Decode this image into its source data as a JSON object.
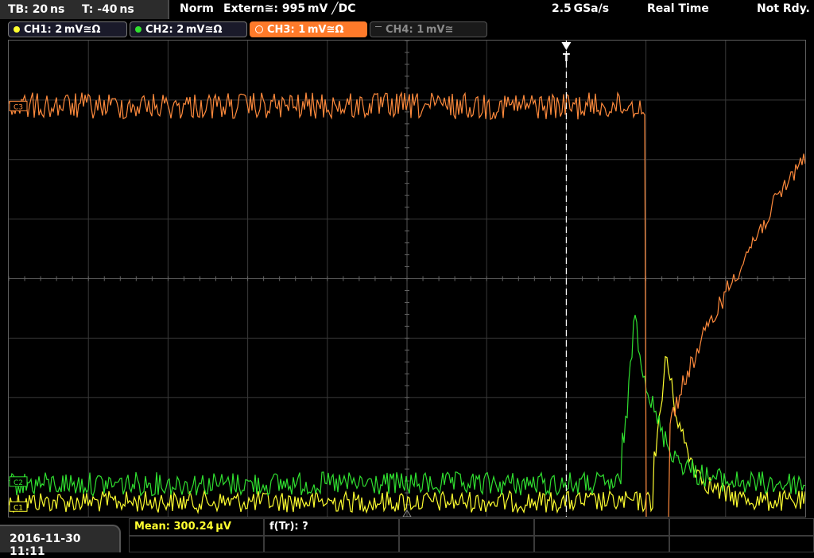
{
  "header": {
    "timebase": "TB: 20 ns",
    "trigger_time": "T: -40 ns",
    "trigger_mode": "Norm",
    "trigger_source": "Extern≅: 995 mV ╱DC",
    "sample_rate": "2.5 GSa/s",
    "acq_mode": "Real Time",
    "status": "Not Rdy."
  },
  "channels": [
    {
      "label": "CH1: 2 mV≅Ω",
      "color": "#ffff30",
      "active": true,
      "selected": false
    },
    {
      "label": "CH2: 2 mV≅Ω",
      "color": "#30e030",
      "active": true,
      "selected": false
    },
    {
      "label": "CH3: 1 mV≅Ω",
      "color": "#ff7a2a",
      "active": true,
      "selected": true
    },
    {
      "label": "CH4: 1 mV≅",
      "color": "#8a8a8a",
      "active": false,
      "selected": false
    }
  ],
  "markers": {
    "trigger": "T",
    "ch3": "C3",
    "ch2": "C2",
    "ch1": "C1"
  },
  "waveforms": {
    "ch3": {
      "color": "#ff8a3c",
      "baseline_div": 1.1,
      "noise_div": 0.45,
      "edge_time_div": 8.0,
      "end_level_div": 1.9
    },
    "ch2": {
      "color": "#30e030",
      "baseline_div": 7.45,
      "noise_div": 0.2,
      "peak_time_div": 7.85,
      "peak_level_div": 4.5
    },
    "ch1": {
      "color": "#ffff30",
      "baseline_div": 7.75,
      "noise_div": 0.18,
      "peak_time_div": 8.25,
      "peak_level_div": 5.2
    }
  },
  "measurements": {
    "mean": "Mean: 300.24 µV",
    "rise_freq": "f(Tr): ?",
    "mean_color": "#ffff30"
  },
  "footer": {
    "datetime": "2016-11-30 11:11"
  }
}
